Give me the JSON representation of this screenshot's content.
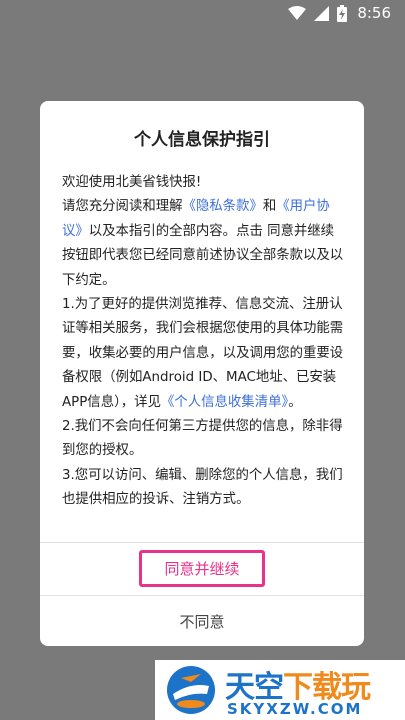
{
  "status_bar": {
    "time": "8:56",
    "icons": [
      "wifi-icon",
      "signal-icon",
      "battery-charging-icon"
    ]
  },
  "dialog": {
    "title": "个人信息保护指引",
    "body": {
      "greeting": "欢迎使用北美省钱快报!",
      "p1_a": "请您充分阅读和理解",
      "privacy_link": "《隐私条款》",
      "p1_b": "和",
      "user_agreement_link": "《用户协议》",
      "p1_c": "以及本指引的全部内容。点击 同意并继续 按钮即代表您已经同意前述协议全部条款以及以下约定。",
      "p2_a": "1.为了更好的提供浏览推荐、信息交流、注册认证等相关服务，我们会根据您使用的具体功能需要，收集必要的用户信息，以及调用您的重要设备权限（例如Android ID、MAC地址、已安装APP信息），详见",
      "info_list_link": "《个人信息收集清单》",
      "p2_b": "。",
      "p3": "2.我们不会向任何第三方提供您的信息，除非得到您的授权。",
      "p4": "3.您可以访问、编辑、删除您的个人信息，我们也提供相应的投诉、注销方式。"
    },
    "agree_label": "同意并继续",
    "disagree_label": "不同意"
  },
  "colors": {
    "overlay": "#7a7a7a",
    "link": "#3b6fd8",
    "highlight": "#e8338a"
  },
  "watermark": {
    "cn_part1": "天空",
    "cn_part2": "下载玩",
    "en": "SKYXZW.COM"
  }
}
